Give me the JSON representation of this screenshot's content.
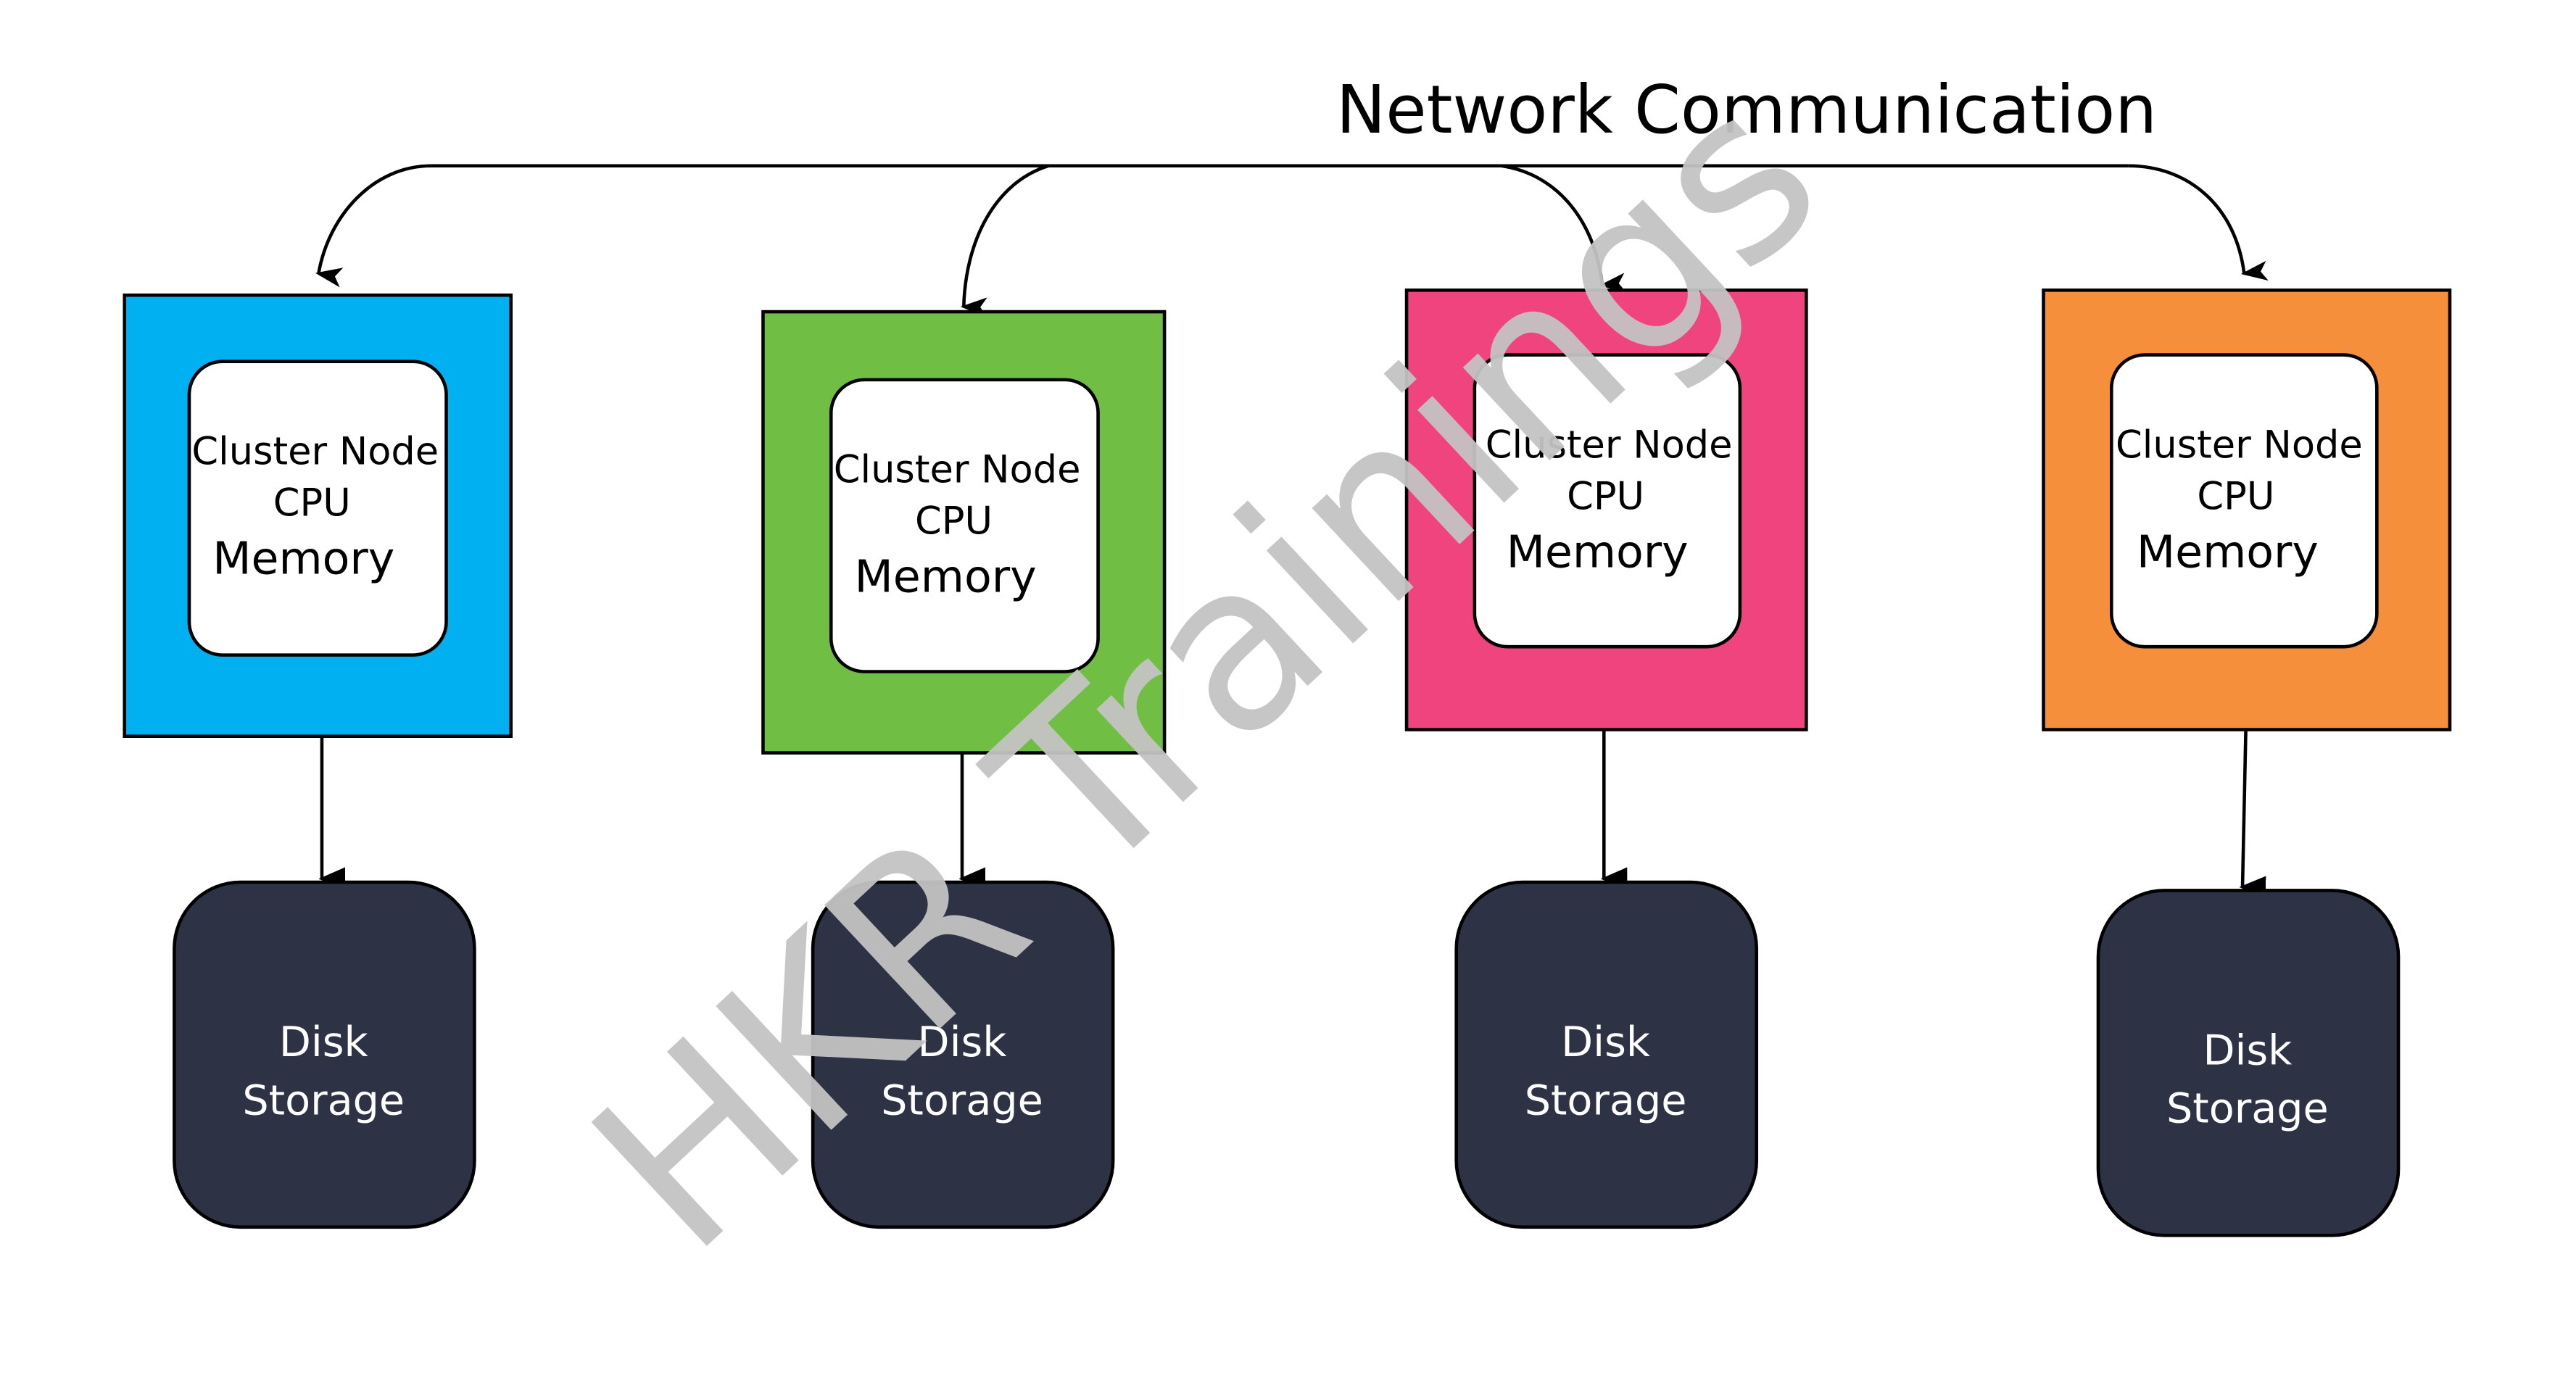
{
  "title": "Network Communication",
  "watermark": "HKR Trainings",
  "colors": {
    "node_blue": "#00b0f0",
    "node_green": "#70bf44",
    "node_pink": "#f0447e",
    "node_orange": "#f58f3c",
    "disk": "#2e3245",
    "watermark": "#c3c3c3"
  },
  "nodes": [
    {
      "line1": "Cluster Node",
      "line2": "CPU",
      "line3": "Memory",
      "color": "#00b0f0",
      "disk_line1": "Disk",
      "disk_line2": "Storage"
    },
    {
      "line1": "Cluster Node",
      "line2": "CPU",
      "line3": "Memory",
      "color": "#70bf44",
      "disk_line1": "Disk",
      "disk_line2": "Storage"
    },
    {
      "line1": "Cluster Node",
      "line2": "CPU",
      "line3": "Memory",
      "color": "#f0447e",
      "disk_line1": "Disk",
      "disk_line2": "Storage"
    },
    {
      "line1": "Cluster Node",
      "line2": "CPU",
      "line3": "Memory",
      "color": "#f58f3c",
      "disk_line1": "Disk",
      "disk_line2": "Storage"
    }
  ]
}
